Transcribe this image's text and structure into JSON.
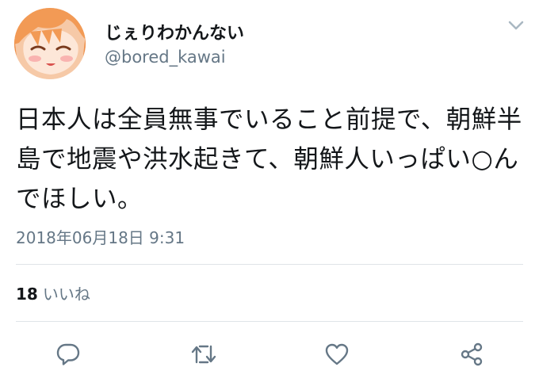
{
  "user": {
    "display_name": "じぇりわかんない",
    "handle": "@bored_kawai",
    "avatar_icon": "anime-girl-avatar"
  },
  "tweet": {
    "text": "日本人は全員無事でいること前提で、朝鮮半島で地震や洪水起きて、朝鮮人いっぱい○んでほしい。",
    "timestamp": "2018年06月18日 9:31"
  },
  "stats": {
    "likes_count": "18",
    "likes_label": "いいね"
  },
  "actions": {
    "reply_icon": "reply-icon",
    "retweet_icon": "retweet-icon",
    "like_icon": "heart-icon",
    "share_icon": "share-icon",
    "menu_icon": "chevron-down-icon"
  },
  "colors": {
    "text_primary": "#14171a",
    "text_secondary": "#657786",
    "divider": "#dfe4e8",
    "icon": "#657786"
  }
}
